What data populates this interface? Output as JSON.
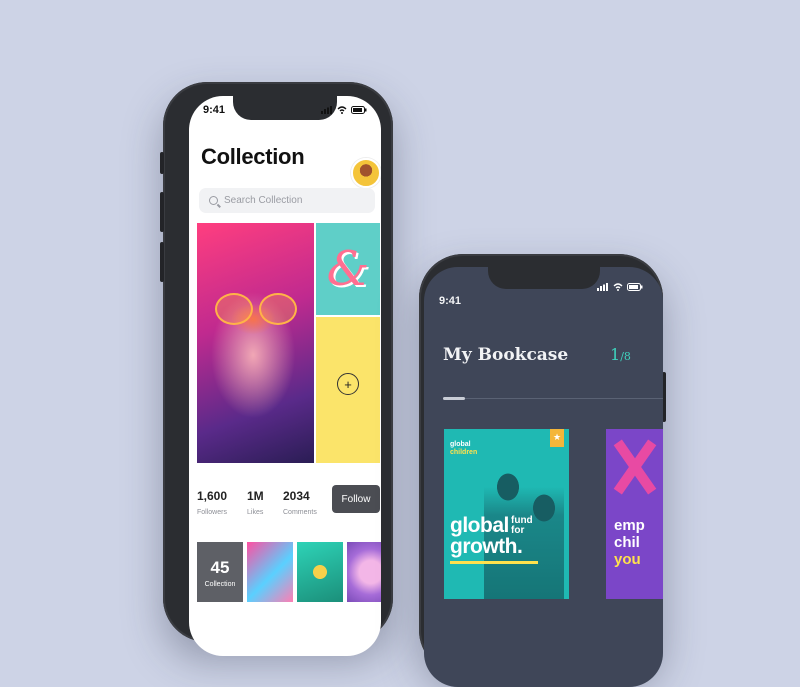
{
  "left_phone": {
    "status_time": "9:41",
    "title": "Collection",
    "search": {
      "placeholder": "Search Collection"
    },
    "add_symbol": "+",
    "ampersand": "&",
    "stats": [
      {
        "value": "1,600",
        "label": "Followers"
      },
      {
        "value": "1M",
        "label": "Likes"
      },
      {
        "value": "2034",
        "label": "Comments"
      }
    ],
    "follow_label": "Follow",
    "collection_tile": {
      "count": "45",
      "label": "Collection"
    }
  },
  "right_phone": {
    "status_time": "9:41",
    "title": "My Bookcase",
    "page_current": "1",
    "page_total": "/8",
    "progress": 0.1,
    "book1": {
      "brand_line1": "global",
      "brand_line2": "children",
      "headline_line1": "global",
      "headline_line2": "growth.",
      "subline_line1": "fund",
      "subline_line2": "for"
    },
    "book2": {
      "line1": "emp",
      "line2": "chil",
      "line3": "you"
    }
  }
}
